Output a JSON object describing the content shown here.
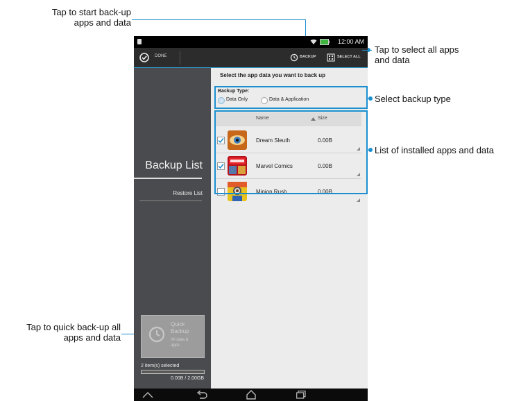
{
  "callouts": {
    "start_backup": [
      "Tap to start back-up",
      "apps and data"
    ],
    "select_all": [
      "Tap to select all apps",
      "and data"
    ],
    "backup_type": "Select backup type",
    "app_list": "List of installed apps and data",
    "quick_backup": [
      "Tap to quick back-up all",
      "apps and data"
    ]
  },
  "status_bar": {
    "time": "12:00 AM"
  },
  "action_bar": {
    "done_label": "DONE",
    "backup_label": "BACKUP",
    "select_all_label": "SELECT ALL"
  },
  "side_panel": {
    "backup_list": "Backup List",
    "restore_list": "Restore List",
    "quick_backup_title": [
      "Quick",
      "Backup"
    ],
    "quick_backup_sub": [
      "All data &",
      "apps"
    ],
    "selected_count": "2 item(s) selected",
    "storage": "0.00B / 2.00GB"
  },
  "content": {
    "heading": "Select the app data you want to back up",
    "backup_type_label": "Backup Type:",
    "option_data_only": "Data Only",
    "option_data_app": "Data & Application",
    "col_name": "Name",
    "col_size": "Size",
    "apps": [
      {
        "name": "Dream Sleuth",
        "size": "0.00B",
        "checked": true
      },
      {
        "name": "Marvel Comics",
        "size": "0.00B",
        "checked": true
      },
      {
        "name": "Minion Rush",
        "size": "0.00B",
        "checked": false
      }
    ]
  },
  "colors": {
    "accent": "#1a8fd0",
    "side_panel": "#4a4b4e",
    "action_bar": "#2c2c2c"
  },
  "icons": [
    "wifi-icon",
    "battery-icon",
    "done-check-icon",
    "backup-icon",
    "select-all-icon",
    "sort-up-icon",
    "home-icon",
    "back-icon",
    "home-nav-icon",
    "recent-apps-icon"
  ]
}
